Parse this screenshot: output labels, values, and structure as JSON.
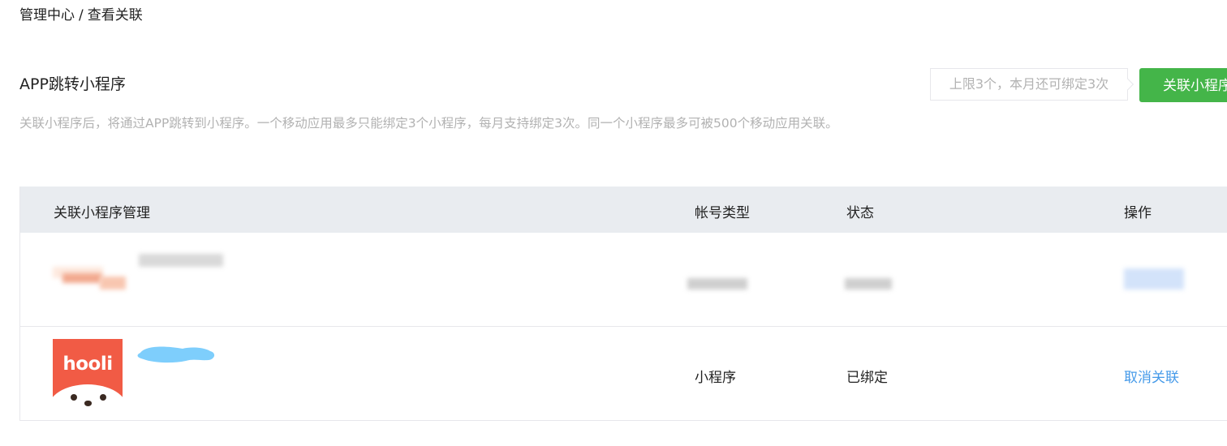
{
  "breadcrumb": {
    "items": [
      "管理中心",
      "查看关联"
    ],
    "separator": "/"
  },
  "section": {
    "title": "APP跳转小程序",
    "description": "关联小程序后，将通过APP跳转到小程序。一个移动应用最多只能绑定3个小程序，每月支持绑定3次。同一个小程序最多可被500个移动应用关联。",
    "limit_tip": "上限3个，本月还可绑定3次",
    "link_button": "关联小程序"
  },
  "table": {
    "headers": {
      "name": "关联小程序管理",
      "account_type": "帐号类型",
      "status": "状态",
      "action": "操作"
    },
    "rows": [
      {
        "name": "",
        "account_type": "",
        "status": "",
        "action": "",
        "redacted": true
      },
      {
        "name": "",
        "avatar_brand": "hooli",
        "account_type": "小程序",
        "status": "已绑定",
        "action": "取消关联",
        "redacted": false
      }
    ]
  },
  "colors": {
    "primary_button": "#44b549",
    "link": "#459ae9",
    "header_bg": "#e9ecf0",
    "muted_text": "#b2b2b2",
    "avatar_bg": "#f15b45"
  },
  "icons": {
    "avatar": "hooli-fox-logo"
  }
}
